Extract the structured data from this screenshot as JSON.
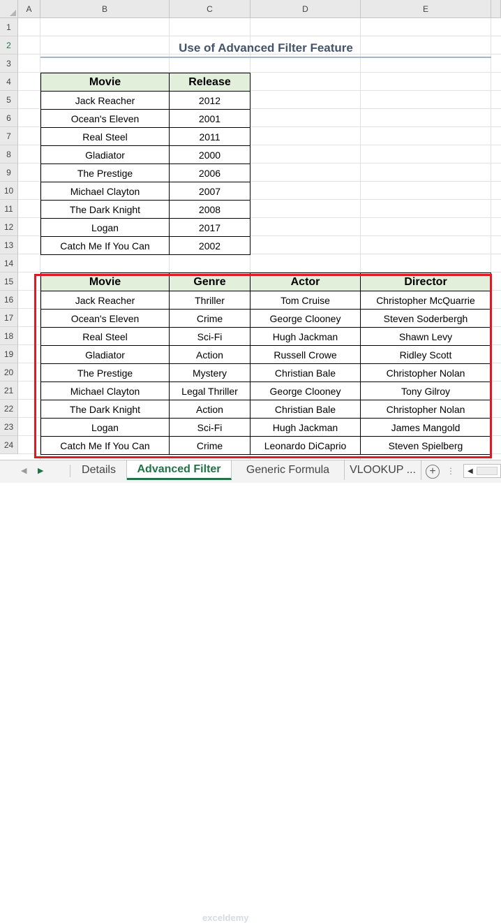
{
  "title": "Use of Advanced Filter Feature",
  "columns": [
    "A",
    "B",
    "C",
    "D",
    "E"
  ],
  "rows": [
    "1",
    "2",
    "3",
    "4",
    "5",
    "6",
    "7",
    "8",
    "9",
    "10",
    "11",
    "12",
    "13",
    "14",
    "15",
    "16",
    "17",
    "18",
    "19",
    "20",
    "21",
    "22",
    "23",
    "24"
  ],
  "table1": {
    "headers": [
      "Movie",
      "Release"
    ],
    "rows": [
      [
        "Jack Reacher",
        "2012"
      ],
      [
        "Ocean's Eleven",
        "2001"
      ],
      [
        "Real Steel",
        "2011"
      ],
      [
        "Gladiator",
        "2000"
      ],
      [
        "The Prestige",
        "2006"
      ],
      [
        "Michael Clayton",
        "2007"
      ],
      [
        "The Dark Knight",
        "2008"
      ],
      [
        "Logan",
        "2017"
      ],
      [
        "Catch Me If You Can",
        "2002"
      ]
    ]
  },
  "table2": {
    "headers": [
      "Movie",
      "Genre",
      "Actor",
      "Director"
    ],
    "rows": [
      [
        "Jack Reacher",
        "Thriller",
        "Tom Cruise",
        "Christopher McQuarrie"
      ],
      [
        "Ocean's Eleven",
        "Crime",
        "George Clooney",
        "Steven Soderbergh"
      ],
      [
        "Real Steel",
        "Sci-Fi",
        "Hugh Jackman",
        "Shawn Levy"
      ],
      [
        "Gladiator",
        "Action",
        "Russell Crowe",
        "Ridley Scott"
      ],
      [
        "The Prestige",
        "Mystery",
        "Christian Bale",
        "Christopher Nolan"
      ],
      [
        "Michael Clayton",
        "Legal Thriller",
        "George Clooney",
        "Tony Gilroy"
      ],
      [
        "The Dark Knight",
        "Action",
        "Christian Bale",
        "Christopher Nolan"
      ],
      [
        "Logan",
        "Sci-Fi",
        "Hugh Jackman",
        "James Mangold"
      ],
      [
        "Catch Me If You Can",
        "Crime",
        "Leonardo DiCaprio",
        "Steven Spielberg"
      ]
    ]
  },
  "tabs": {
    "items": [
      "Details",
      "Advanced Filter",
      "Generic Formula",
      "VLOOKUP ..."
    ],
    "active": "Advanced Filter",
    "add_label": "+"
  },
  "watermark": "exceldemy",
  "colors": {
    "header_fill": "#e2efda",
    "title_text": "#44546a",
    "highlight_border": "#e0181f",
    "excel_green": "#217346"
  },
  "icons": {
    "nav_prev": "triangle-left-icon",
    "nav_next": "triangle-right-icon",
    "add_sheet": "plus-circle-icon",
    "scroll_left": "chevron-left-icon"
  }
}
